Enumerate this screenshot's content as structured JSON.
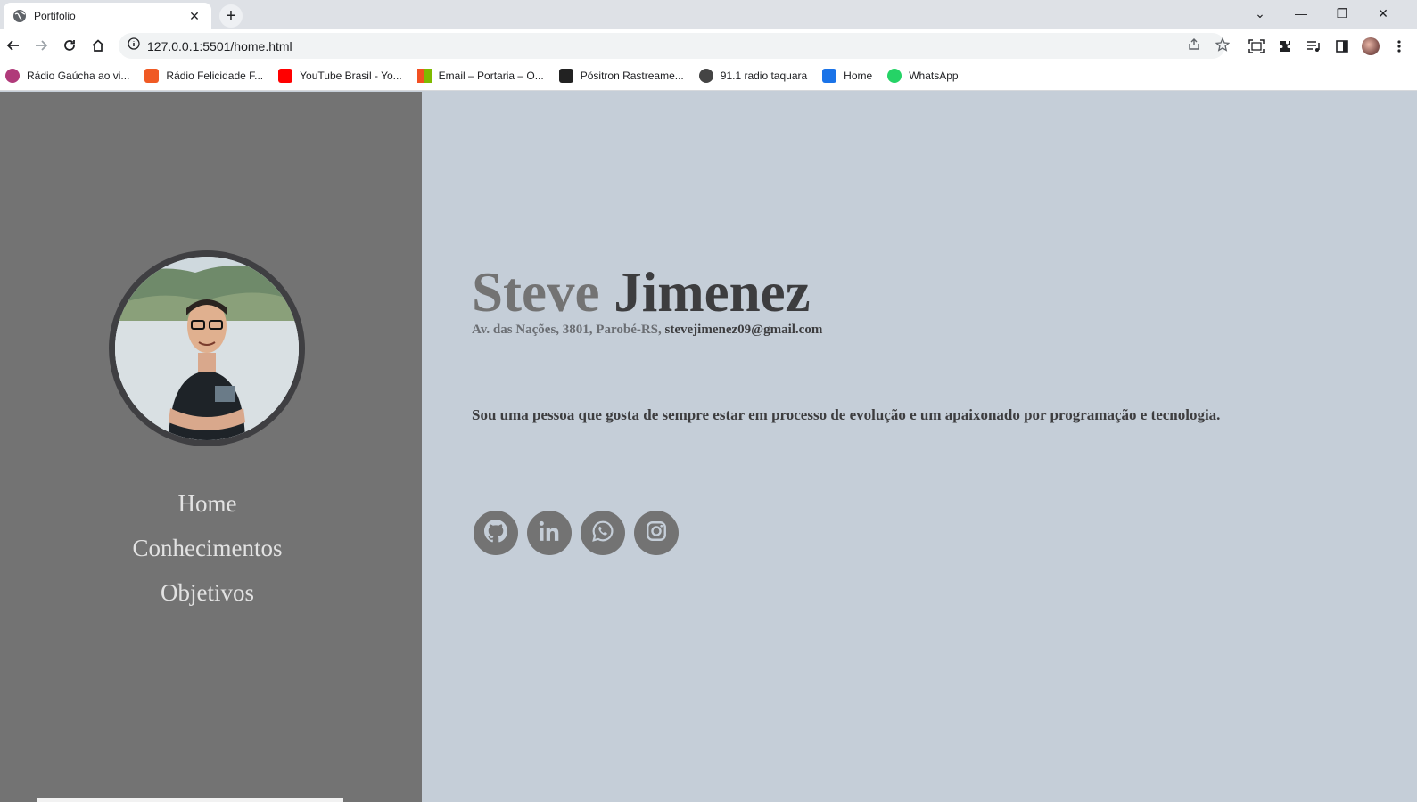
{
  "browser": {
    "tab_title": "Portifolio",
    "tab_close": "✕",
    "new_tab": "+",
    "url": "127.0.0.1:5501/home.html",
    "window_controls": {
      "tab_search": "⌄",
      "minimize": "—",
      "restore": "❐",
      "close": "✕"
    },
    "bookmarks": [
      {
        "label": "Rádio Gaúcha ao vi...",
        "icon": "radio-gaucha-icon",
        "color": "#b03a7a"
      },
      {
        "label": "Rádio Felicidade F...",
        "icon": "radio-felicidade-icon",
        "color": "#f05a24"
      },
      {
        "label": "YouTube Brasil - Yo...",
        "icon": "youtube-icon",
        "color": "#ff0000"
      },
      {
        "label": "Email – Portaria – O...",
        "icon": "microsoft-icon",
        "color": "#f25022"
      },
      {
        "label": "Pósitron Rastreame...",
        "icon": "positron-icon",
        "color": "#222222"
      },
      {
        "label": "91.1 radio taquara",
        "icon": "podcast-icon",
        "color": "#444444"
      },
      {
        "label": "Home",
        "icon": "home-bookmark-icon",
        "color": "#1a73e8"
      },
      {
        "label": "WhatsApp",
        "icon": "whatsapp-icon",
        "color": "#25d366"
      }
    ]
  },
  "sidebar": {
    "nav": [
      {
        "label": "Home"
      },
      {
        "label": "Conhecimentos"
      },
      {
        "label": "Objetivos"
      }
    ]
  },
  "hero": {
    "first_name": "Steve",
    "last_name": "Jimenez",
    "address": "Av. das Nações, 3801, Parobé-RS,",
    "email": "stevejimenez09@gmail.com",
    "bio": "Sou uma pessoa que gosta de sempre estar em processo de evolução e um apaixonado por programação e tecnologia."
  },
  "social": [
    {
      "icon": "github-icon"
    },
    {
      "icon": "linkedin-icon"
    },
    {
      "icon": "whatsapp-icon"
    },
    {
      "icon": "instagram-icon"
    }
  ],
  "colors": {
    "sidebar_bg": "#737373",
    "main_bg": "#c5ced8",
    "name_first": "#737373",
    "name_last": "#3d3d3f",
    "nav_text": "#e2e2e2"
  }
}
